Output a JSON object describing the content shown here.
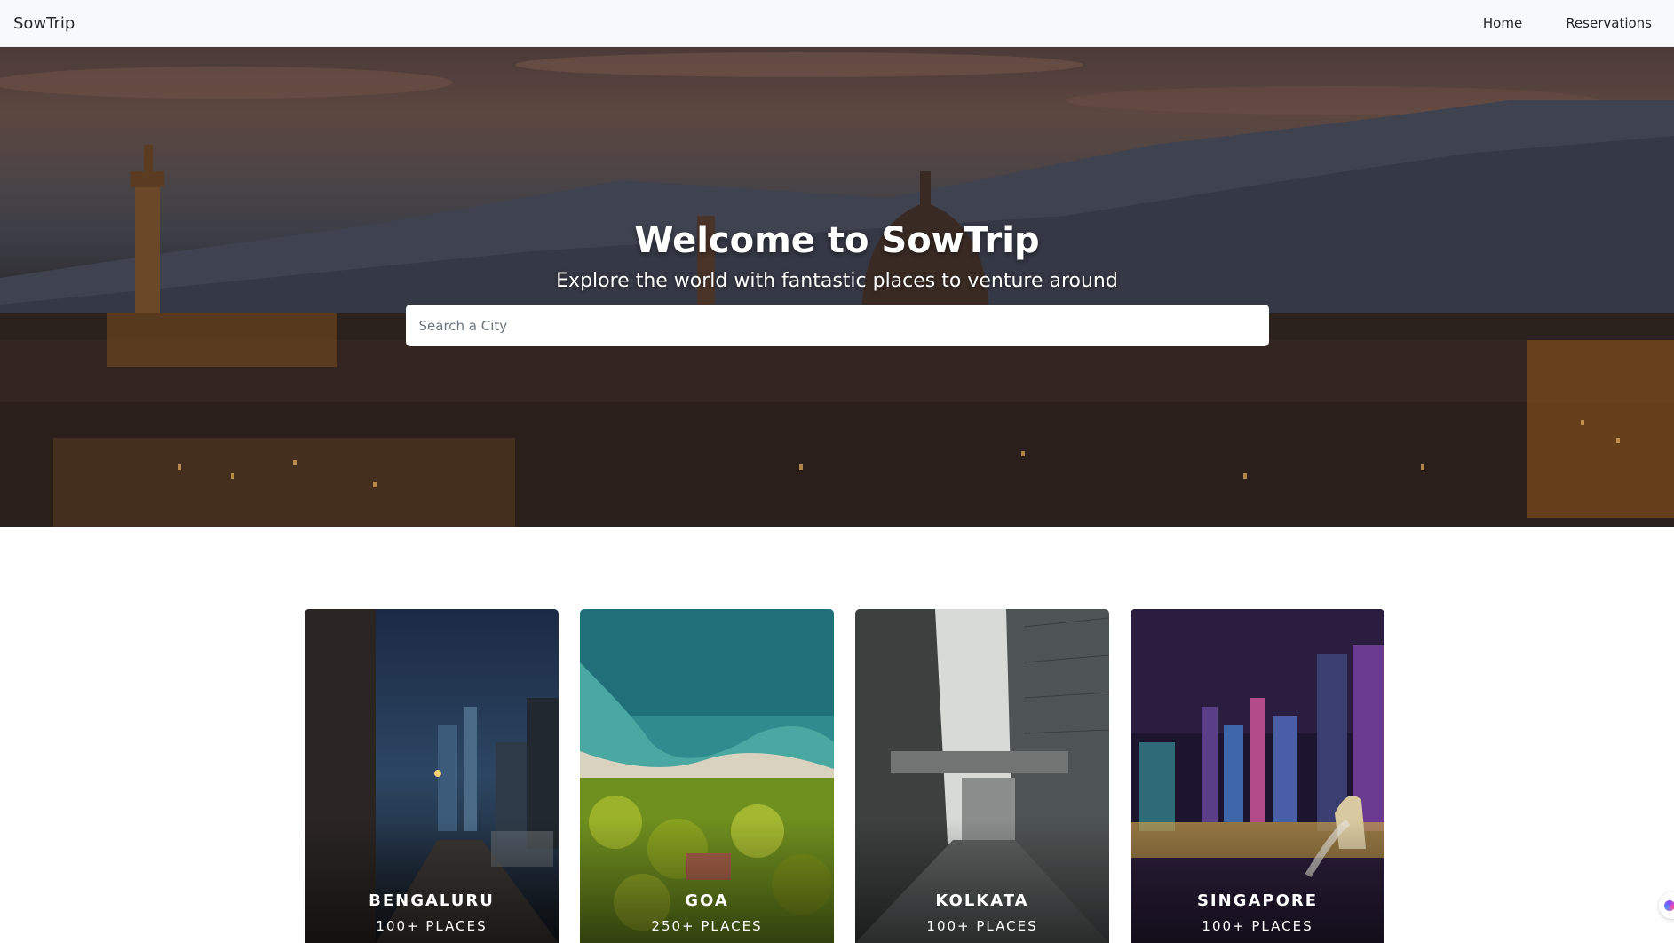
{
  "navbar": {
    "brand": "SowTrip",
    "links": [
      {
        "label": "Home"
      },
      {
        "label": "Reservations"
      }
    ]
  },
  "hero": {
    "title": "Welcome to SowTrip",
    "subtitle": "Explore the world with fantastic places to venture around",
    "search": {
      "placeholder": "Search a City",
      "value": ""
    }
  },
  "cities": [
    {
      "name": "BENGALURU",
      "places": "100+ PLACES"
    },
    {
      "name": "GOA",
      "places": "250+ PLACES"
    },
    {
      "name": "KOLKATA",
      "places": "100+ PLACES"
    },
    {
      "name": "SINGAPORE",
      "places": "100+ PLACES"
    }
  ],
  "colors": {
    "navbar_bg": "#f8f9fa",
    "hero_sky": "#5d4740",
    "text_light": "#ffffff"
  }
}
